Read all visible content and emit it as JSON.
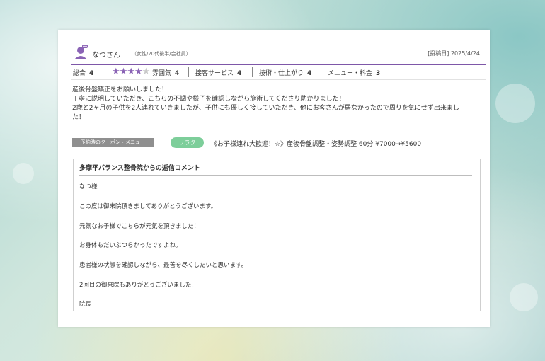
{
  "review": {
    "user_name": "なつさん",
    "user_meta": "（女性/20代後半/会社員）",
    "posted": "[投稿日] 2025/4/24",
    "overall_label": "総合",
    "overall_value": "4",
    "star_rating": 4,
    "star_max": 5,
    "ratings": [
      {
        "label": "雰囲気",
        "value": "4"
      },
      {
        "label": "接客サービス",
        "value": "4"
      },
      {
        "label": "技術・仕上がり",
        "value": "4"
      },
      {
        "label": "メニュー・料金",
        "value": "3"
      }
    ],
    "body_lines": [
      "産後骨盤矯正をお願いしました！",
      "丁寧に説明していただき、こちらの不調や様子を確認しながら施術してくださり助かりました！",
      "2歳と2ヶ月の子供を2人連れていきましたが、子供にも優しく接していただき、他にお客さんが居なかったので周りを気にせず出来まし",
      "た！"
    ],
    "coupon_label": "予約時のクーポン・メニュー",
    "coupon_tag": "リラク",
    "coupon_text": "《お子様連れ大歓迎！☆》産後骨盤調整・姿勢調整 60分 ¥7000→¥5600"
  },
  "reply": {
    "title": "多摩平バランス整骨院からの返信コメント",
    "lines": [
      "なつ様",
      "この度は御来院頂きましてありがとうございます。",
      "元気なお子様でこちらが元気を頂きました！",
      "お身体もだいぶつらかったですよね。",
      "患者様の状態を確認しながら、最善を尽くしたいと思います。",
      "2回目の御来院もありがとうございました！",
      "院長"
    ]
  },
  "colors": {
    "accent_purple": "#7e57a8",
    "star_color": "#8a63b5",
    "tag_green": "#7dce9a",
    "coupon_gray": "#8f8f8f"
  },
  "icons": {
    "avatar": "user-avatar-icon",
    "star": "star-icon"
  }
}
